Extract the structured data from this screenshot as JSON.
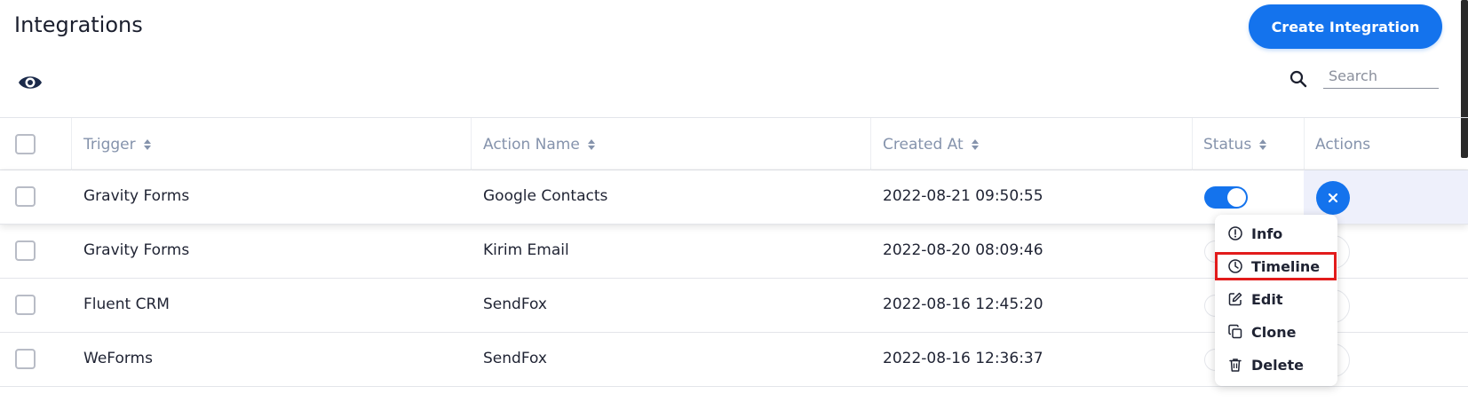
{
  "header": {
    "title": "Integrations",
    "create_button": "Create Integration",
    "search_placeholder": "Search"
  },
  "icons": {
    "visibility": "eye-icon",
    "search": "search-icon"
  },
  "colors": {
    "accent": "#1473ed",
    "highlight": "#e21b1b",
    "header_text": "#8593ac"
  },
  "table": {
    "columns": [
      "Trigger",
      "Action Name",
      "Created At",
      "Status",
      "Actions"
    ],
    "rows": [
      {
        "trigger": "Gravity Forms",
        "action_name": "Google Contacts",
        "created_at": "2022-08-21 09:50:55",
        "status": "on"
      },
      {
        "trigger": "Gravity Forms",
        "action_name": "Kirim Email",
        "created_at": "2022-08-20 08:09:46",
        "status": ""
      },
      {
        "trigger": "Fluent CRM",
        "action_name": "SendFox",
        "created_at": "2022-08-16 12:45:20",
        "status": ""
      },
      {
        "trigger": "WeForms",
        "action_name": "SendFox",
        "created_at": "2022-08-16 12:36:37",
        "status": ""
      }
    ]
  },
  "context_menu": {
    "items": [
      "Info",
      "Timeline",
      "Edit",
      "Clone",
      "Delete"
    ],
    "highlighted": "Timeline"
  }
}
